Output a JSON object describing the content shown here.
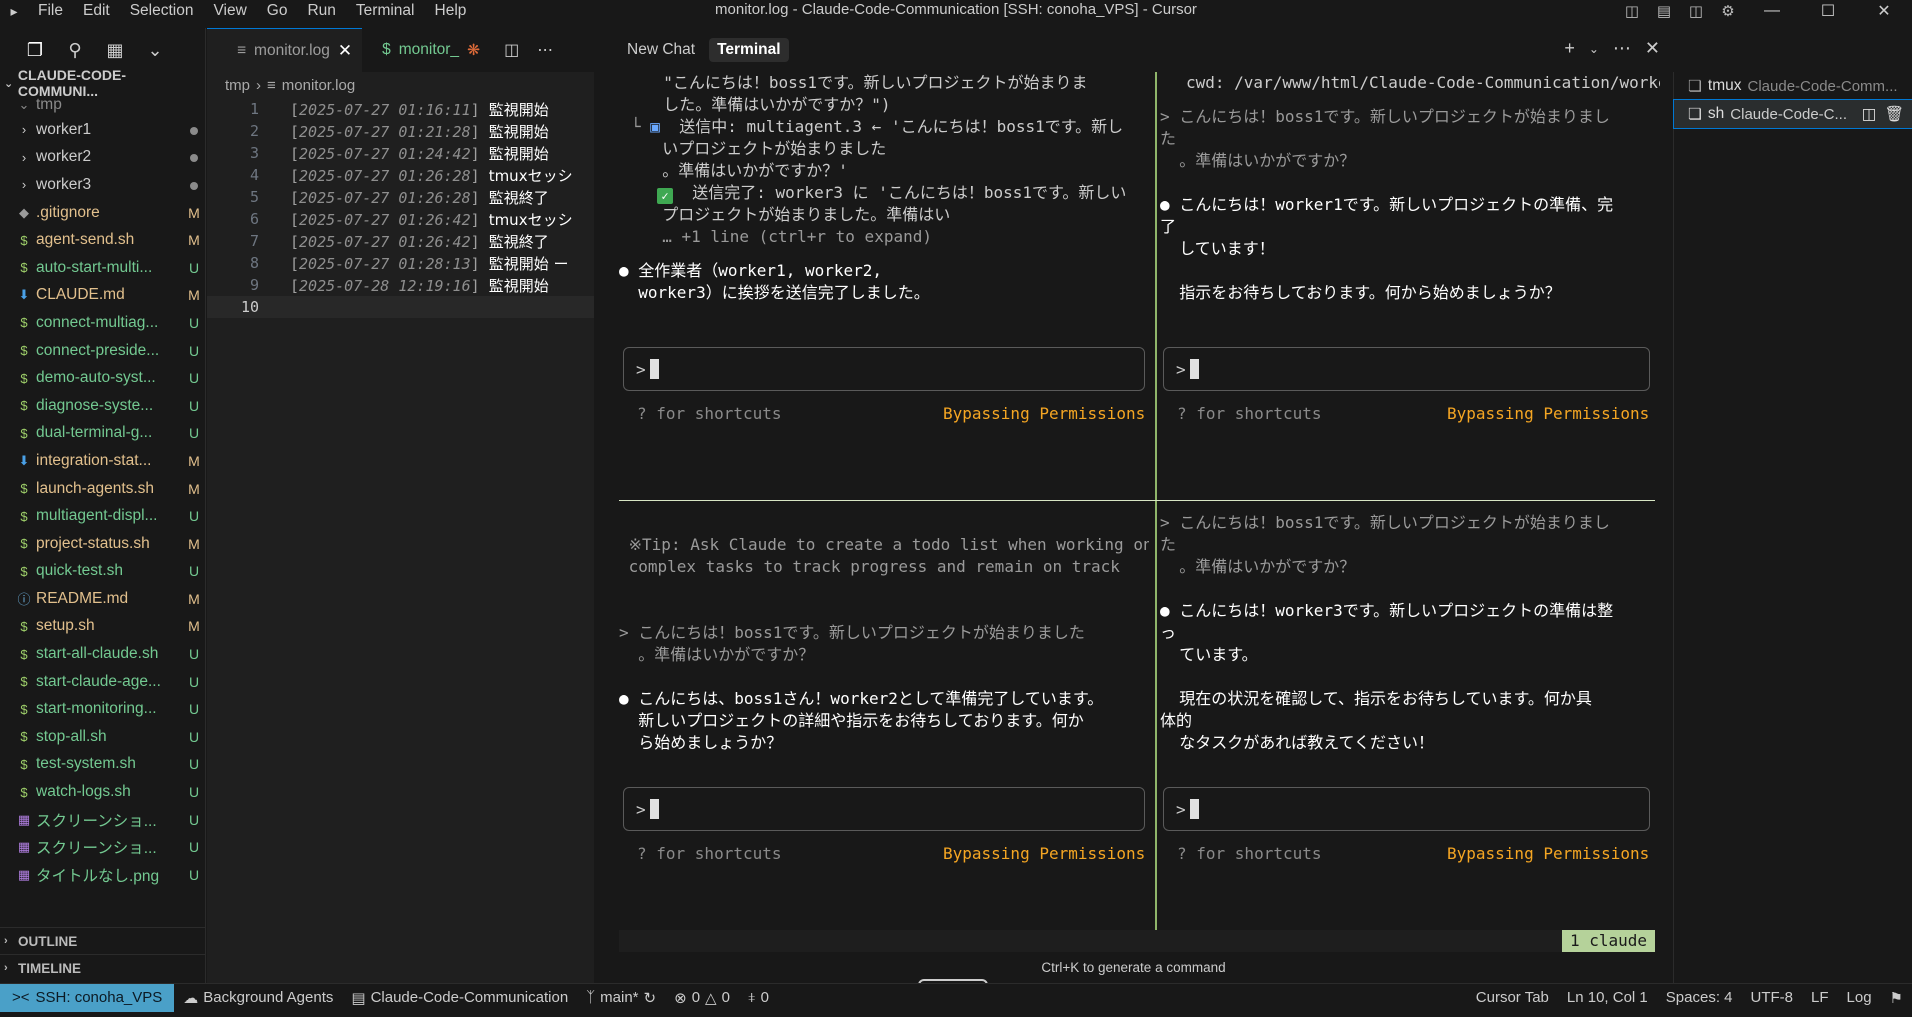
{
  "window": {
    "title": "monitor.log - Claude-Code-Communication [SSH: conoha_VPS] - Cursor"
  },
  "menu": [
    "File",
    "Edit",
    "Selection",
    "View",
    "Go",
    "Run",
    "Terminal",
    "Help"
  ],
  "explorer": {
    "root_label": "CLAUDE-CODE-COMMUNI...",
    "folder_label": "tmp",
    "items": [
      {
        "name": "worker1",
        "type": "folder",
        "status": "dot"
      },
      {
        "name": "worker2",
        "type": "folder",
        "status": "dot"
      },
      {
        "name": "worker3",
        "type": "folder",
        "status": "dot"
      },
      {
        "name": ".gitignore",
        "type": "git",
        "status": "M"
      },
      {
        "name": "agent-send.sh",
        "type": "sh",
        "status": "M"
      },
      {
        "name": "auto-start-multi...",
        "type": "sh",
        "status": "U"
      },
      {
        "name": "CLAUDE.md",
        "type": "md",
        "status": "M"
      },
      {
        "name": "connect-multiag...",
        "type": "sh",
        "status": "U"
      },
      {
        "name": "connect-preside...",
        "type": "sh",
        "status": "U"
      },
      {
        "name": "demo-auto-syst...",
        "type": "sh",
        "status": "U"
      },
      {
        "name": "diagnose-syste...",
        "type": "sh",
        "status": "U"
      },
      {
        "name": "dual-terminal-g...",
        "type": "sh",
        "status": "U"
      },
      {
        "name": "integration-stat...",
        "type": "md",
        "status": "M"
      },
      {
        "name": "launch-agents.sh",
        "type": "sh",
        "status": "M"
      },
      {
        "name": "multiagent-displ...",
        "type": "sh",
        "status": "U"
      },
      {
        "name": "project-status.sh",
        "type": "sh",
        "status": "M"
      },
      {
        "name": "quick-test.sh",
        "type": "sh",
        "status": "U"
      },
      {
        "name": "README.md",
        "type": "info",
        "status": "M"
      },
      {
        "name": "setup.sh",
        "type": "sh",
        "status": "M"
      },
      {
        "name": "start-all-claude.sh",
        "type": "sh",
        "status": "U"
      },
      {
        "name": "start-claude-age...",
        "type": "sh",
        "status": "U"
      },
      {
        "name": "start-monitoring...",
        "type": "sh",
        "status": "U"
      },
      {
        "name": "stop-all.sh",
        "type": "sh",
        "status": "U"
      },
      {
        "name": "test-system.sh",
        "type": "sh",
        "status": "U"
      },
      {
        "name": "watch-logs.sh",
        "type": "sh",
        "status": "U"
      },
      {
        "name": "スクリーンショ...",
        "type": "img",
        "status": "U"
      },
      {
        "name": "スクリーンショ...",
        "type": "img",
        "status": "U"
      },
      {
        "name": "タイトルなし.png",
        "type": "img",
        "status": "U"
      }
    ],
    "outline_label": "OUTLINE",
    "timeline_label": "TIMELINE"
  },
  "editor": {
    "tabs": [
      {
        "label": "monitor.log",
        "active": true
      },
      {
        "label": "monitor_",
        "active": false
      }
    ],
    "breadcrumb": [
      "tmp",
      "monitor.log"
    ],
    "lines": [
      {
        "n": "1",
        "ts": "2025-07-27 01:16:11",
        "msg": "監視開始"
      },
      {
        "n": "2",
        "ts": "2025-07-27 01:21:28",
        "msg": "監視開始"
      },
      {
        "n": "3",
        "ts": "2025-07-27 01:24:42",
        "msg": "監視開始"
      },
      {
        "n": "4",
        "ts": "2025-07-27 01:26:28",
        "msg": "tmuxセッシ"
      },
      {
        "n": "5",
        "ts": "2025-07-27 01:26:28",
        "msg": "監視終了"
      },
      {
        "n": "6",
        "ts": "2025-07-27 01:26:42",
        "msg": "tmuxセッシ"
      },
      {
        "n": "7",
        "ts": "2025-07-27 01:26:42",
        "msg": "監視終了"
      },
      {
        "n": "8",
        "ts": "2025-07-27 01:28:13",
        "msg": "監視開始 ー"
      },
      {
        "n": "9",
        "ts": "2025-07-28 12:19:16",
        "msg": "監視開始"
      },
      {
        "n": "10",
        "ts": "",
        "msg": ""
      }
    ]
  },
  "terminal": {
    "tabs": [
      "New Chat",
      "Terminal"
    ],
    "pane_tl": {
      "lines": [
        "  \"こんにちは！boss1です。新しいプロジェクトが始まりま",
        "  した。準備はいかがですか？\")",
        "  送信中: multiagent.3 ← 'こんにちは！boss1です。新し",
        "  いプロジェクトが始まりました",
        "  。準備はいかがですか？'",
        "  送信完了: worker3 に 'こんにちは！boss1です。新しい",
        "  プロジェクトが始まりました。準備はい",
        "  … +1 line (ctrl+r to expand)",
        "● 全作業者（worker1, worker2,",
        "  worker3）に挨拶を送信完了しました。"
      ]
    },
    "pane_tr": {
      "cwd": "cwd: /var/www/html/Claude-Code-Communication/worker1",
      "lines": [
        "> こんにちは！boss1です。新しいプロジェクトが始まりまし",
        "た",
        "  。準備はいかがですか？",
        "● こんにちは！worker1です。新しいプロジェクトの準備、完",
        "了",
        "  しています！",
        "  指示をお待ちしております。何から始めましょうか？"
      ]
    },
    "pane_bl": {
      "lines": [
        " ※Tip: Ask Claude to create a todo list when working on",
        " complex tasks to track progress and remain on track",
        "> こんにちは！boss1です。新しいプロジェクトが始まりました",
        "  。準備はいかがですか？",
        "● こんにちは、boss1さん！worker2として準備完了しています。",
        "  新しいプロジェクトの詳細や指示をお待ちしております。何か",
        "  ら始めましょうか？"
      ]
    },
    "pane_br": {
      "lines": [
        "> こんにちは！boss1です。新しいプロジェクトが始まりまし",
        "た",
        "  。準備はいかがですか？",
        "● こんにちは！worker3です。新しいプロジェクトの準備は整",
        "っ",
        "  ています。",
        "  現在の状況を確認して、指示をお待ちしています。何か具",
        "体的",
        "  なタスクがあれば教えてください！"
      ]
    },
    "prompt": ">",
    "shortcuts_hint": "? for shortcuts",
    "bypass_label": "Bypassing Permissions",
    "tmux_window": "1 claude",
    "generate_hint": "Ctrl+K to generate a command",
    "list": [
      {
        "name": "tmux",
        "desc": "Claude-Code-Comm..."
      },
      {
        "name": "sh",
        "desc": "Claude-Code-C..."
      }
    ]
  },
  "statusbar": {
    "remote": "SSH: conoha_VPS",
    "background_agents": "Background Agents",
    "workspace": "Claude-Code-Communication",
    "branch": "main*",
    "errors": "0",
    "warnings": "0",
    "ports": "0",
    "cursor_tab": "Cursor Tab",
    "position": "Ln 10, Col 1",
    "spaces": "Spaces: 4",
    "encoding": "UTF-8",
    "eol": "LF",
    "language": "Log"
  },
  "colors": {
    "accent": "#0078d4",
    "modified": "#e2c08d",
    "untracked": "#73c991",
    "bypass": "#f5a623",
    "tmux_green": "#b5d29a",
    "remote": "#4aa0c8"
  }
}
